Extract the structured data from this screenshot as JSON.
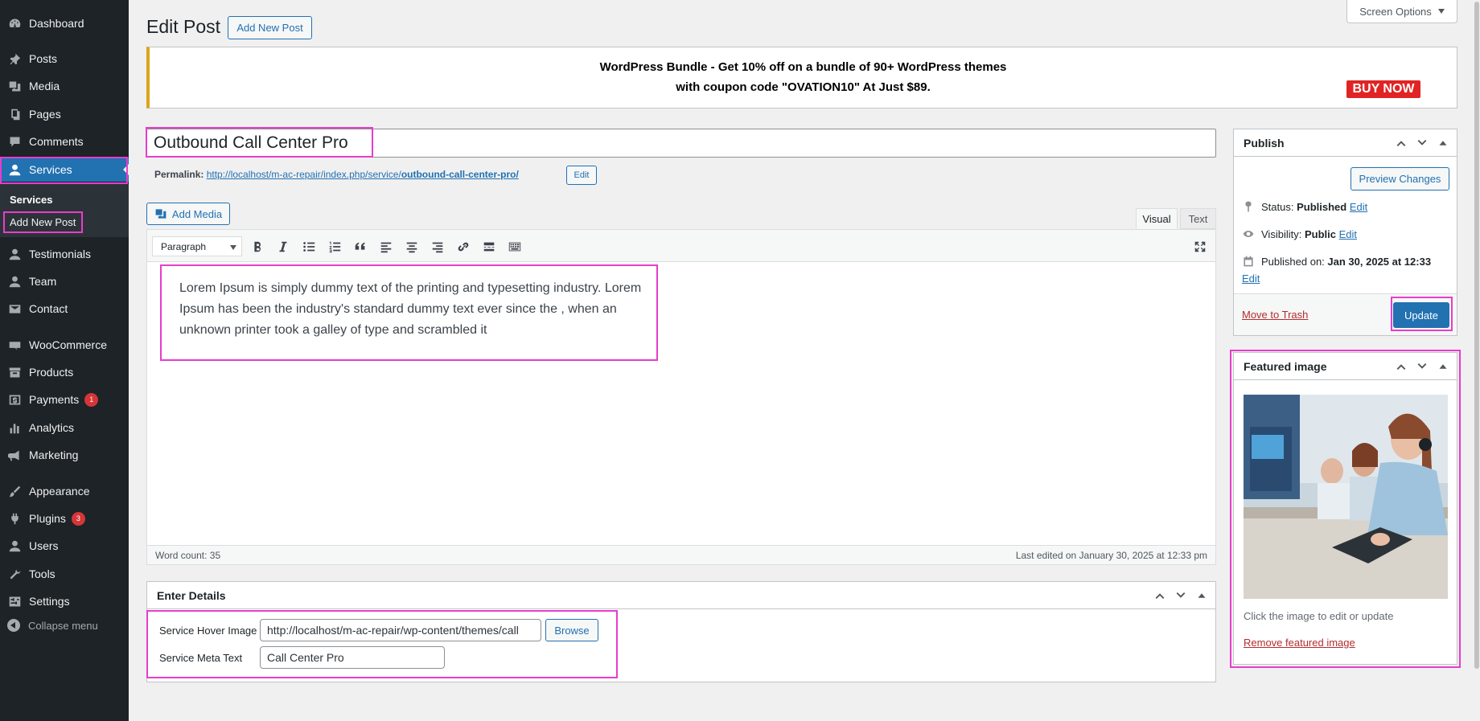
{
  "sidebar": {
    "items": [
      {
        "label": "Dashboard",
        "icon": "dashboard-icon"
      },
      {
        "label": "Posts",
        "icon": "pin-icon"
      },
      {
        "label": "Media",
        "icon": "media-icon"
      },
      {
        "label": "Pages",
        "icon": "pages-icon"
      },
      {
        "label": "Comments",
        "icon": "comment-icon"
      },
      {
        "label": "Services",
        "icon": "user-icon"
      },
      {
        "label": "Testimonials",
        "icon": "user-icon"
      },
      {
        "label": "Team",
        "icon": "user-icon"
      },
      {
        "label": "Contact",
        "icon": "mail-icon"
      },
      {
        "label": "WooCommerce",
        "icon": "woo-icon"
      },
      {
        "label": "Products",
        "icon": "archive-icon"
      },
      {
        "label": "Payments",
        "icon": "dollar-icon",
        "badge": "1"
      },
      {
        "label": "Analytics",
        "icon": "chart-bar-icon"
      },
      {
        "label": "Marketing",
        "icon": "megaphone-icon"
      },
      {
        "label": "Appearance",
        "icon": "brush-icon"
      },
      {
        "label": "Plugins",
        "icon": "plugin-icon",
        "badge": "3"
      },
      {
        "label": "Users",
        "icon": "user-icon"
      },
      {
        "label": "Tools",
        "icon": "wrench-icon"
      },
      {
        "label": "Settings",
        "icon": "settings-icon"
      }
    ],
    "submenu": {
      "title": "Services",
      "link": "Add New Post"
    },
    "collapse_label": "Collapse menu"
  },
  "header": {
    "title": "Edit Post",
    "add_new_label": "Add New Post",
    "screen_options": "Screen Options"
  },
  "notice": {
    "line1": "WordPress Bundle - Get 10% off on a bundle of 90+ WordPress themes",
    "line2": "with coupon code \"OVATION10\" At Just $89.",
    "buy_now": "BUY NOW"
  },
  "post": {
    "title": "Outbound Call Center Pro",
    "permalink_label": "Permalink:",
    "permalink_base": "http://localhost/m-ac-repair/index.php/service/",
    "permalink_slug": "outbound-call-center-pro/",
    "permalink_edit": "Edit"
  },
  "editor": {
    "add_media": "Add Media",
    "tab_visual": "Visual",
    "tab_text": "Text",
    "format_select": "Paragraph",
    "content": "Lorem Ipsum is simply dummy text of the printing and typesetting industry. Lorem Ipsum has been the industry's standard dummy text ever since the , when an unknown printer took a galley of type and scrambled it",
    "word_count": "Word count: 35",
    "last_edited": "Last edited on January 30, 2025 at 12:33 pm"
  },
  "details": {
    "title": "Enter Details",
    "hover_image_label": "Service Hover Image",
    "hover_image_value": "http://localhost/m-ac-repair/wp-content/themes/call",
    "browse_label": "Browse",
    "meta_text_label": "Service Meta Text",
    "meta_text_value": "Call Center Pro"
  },
  "publish": {
    "title": "Publish",
    "preview_label": "Preview Changes",
    "status_label": "Status:",
    "status_value": "Published",
    "visibility_label": "Visibility:",
    "visibility_value": "Public",
    "published_on_label": "Published on:",
    "published_on_value": "Jan 30, 2025 at 12:33",
    "edit_label": "Edit",
    "trash_label": "Move to Trash",
    "update_label": "Update"
  },
  "featured": {
    "title": "Featured image",
    "caption": "Click the image to edit or update",
    "remove_label": "Remove featured image"
  },
  "colors": {
    "accent": "#2271b1",
    "sidebar_bg": "#1d2327",
    "highlight": "#e83ccd",
    "danger": "#b32d2e",
    "notice_border": "#dba617"
  }
}
